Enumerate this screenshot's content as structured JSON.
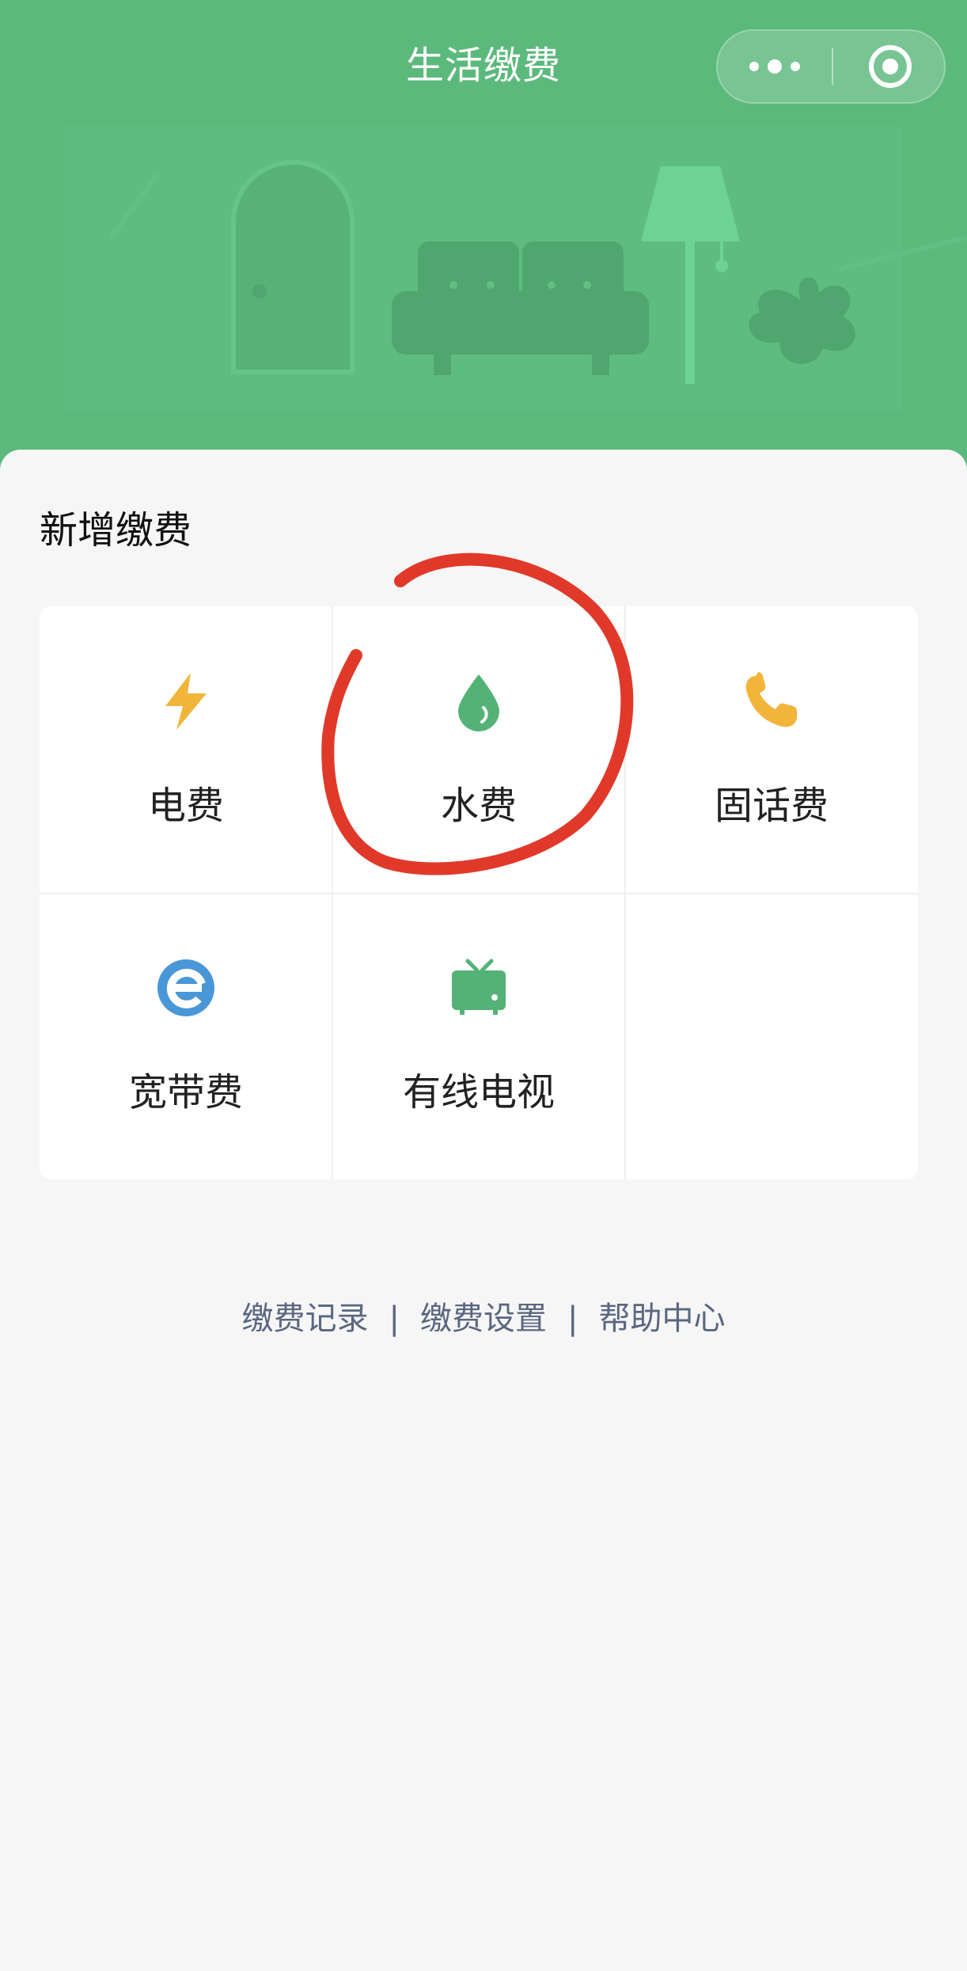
{
  "header": {
    "title": "生活缴费",
    "more_icon": "more-dots-icon",
    "close_icon": "target-close-icon",
    "background_color": "#5bb97c"
  },
  "section": {
    "title": "新增缴费"
  },
  "services": [
    {
      "label": "电费",
      "icon": "lightning-icon",
      "color": "#f2b53a"
    },
    {
      "label": "水费",
      "icon": "water-drop-icon",
      "color": "#54b276"
    },
    {
      "label": "固话费",
      "icon": "phone-icon",
      "color": "#f2b53a"
    },
    {
      "label": "宽带费",
      "icon": "broadband-e-icon",
      "color": "#4a97d8"
    },
    {
      "label": "有线电视",
      "icon": "tv-icon",
      "color": "#54b276"
    }
  ],
  "footer": {
    "links": [
      "缴费记录",
      "缴费设置",
      "帮助中心"
    ],
    "separator": "|"
  },
  "annotation": {
    "color": "#e0392a",
    "target": "水费"
  }
}
